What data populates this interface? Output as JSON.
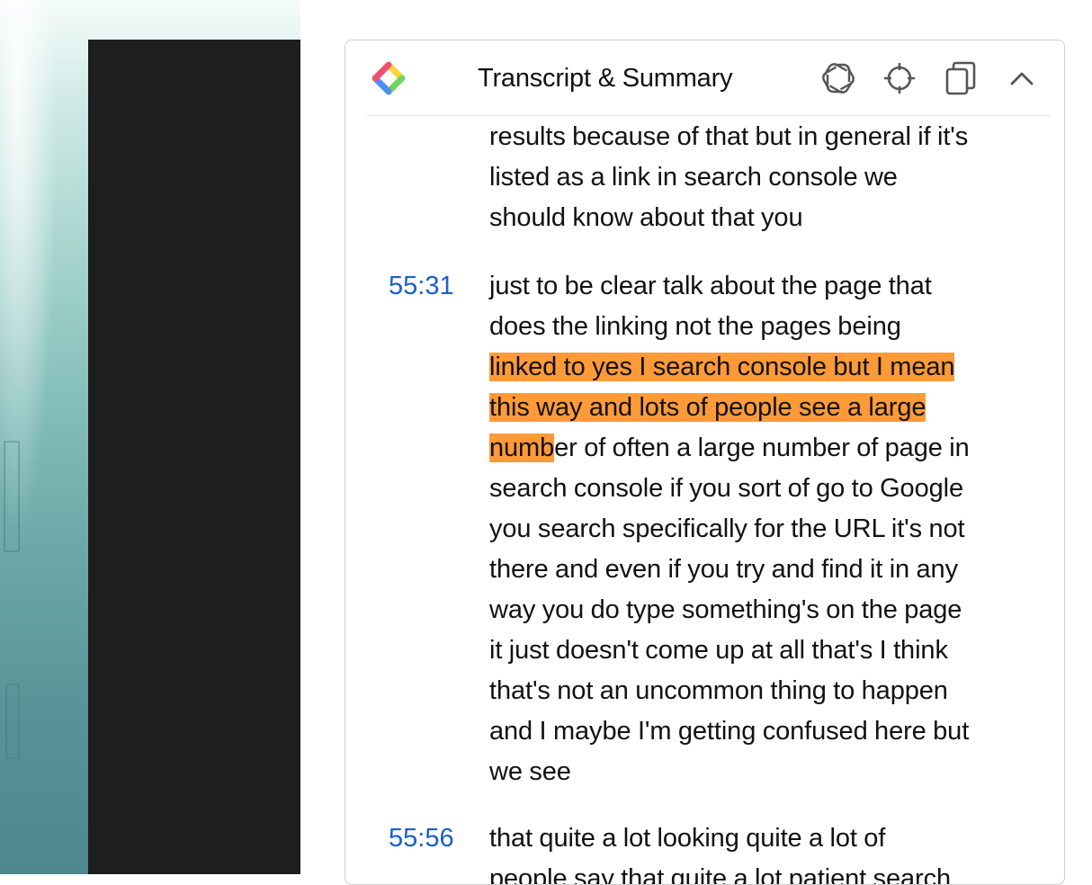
{
  "header": {
    "title": "Transcript & Summary",
    "logo_icon": "colorful-diamond-logo",
    "buttons": [
      "chatgpt-icon",
      "crosshair-icon",
      "copy-icon",
      "chevron-up-icon"
    ]
  },
  "transcript": {
    "highlight_color": "#ff9a38",
    "timestamp_color": "#1a5fc4",
    "segments": [
      {
        "time": "",
        "lines": [
          "results because of that but in general if it's",
          "listed as a link in search console we",
          "should know about that you"
        ]
      },
      {
        "time": "55:31",
        "line1": "just to be clear talk about the page that",
        "line2": "does the linking not the pages being",
        "line3_highlight": "linked to yes I search console but I mean",
        "line4_highlight": "this way and lots of people see a large",
        "line5_highlight": "numb",
        "line5_rest": "er of often a large number of page in",
        "rest": [
          "search console if you sort of go to Google",
          "you search specifically for the URL it's not",
          "there and even if you try and find it in any",
          "way you do type something's on the page",
          "it just doesn't come up at all that's I think",
          "that's not an uncommon thing to happen",
          "and I maybe I'm getting confused here but",
          "we see"
        ]
      },
      {
        "time": "55:56",
        "lines": [
          "that quite a lot looking quite a lot of",
          "people say that quite a lot patient search"
        ]
      }
    ]
  }
}
